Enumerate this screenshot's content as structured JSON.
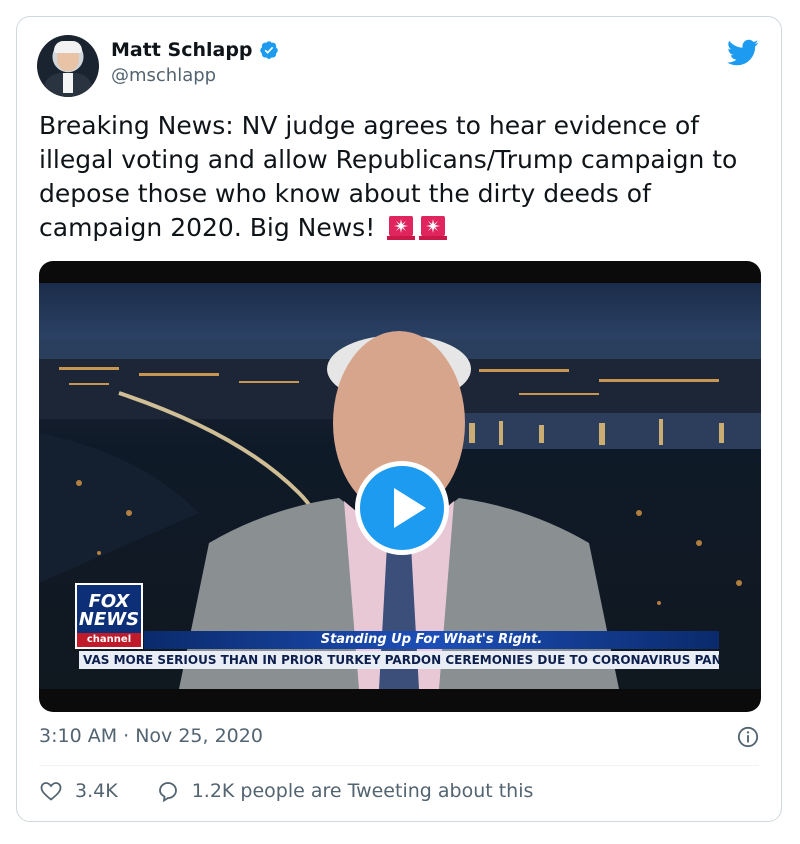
{
  "author": {
    "name": "Matt Schlapp",
    "handle": "@mschlapp"
  },
  "tweet": {
    "text": "Breaking News: NV judge agrees to hear evidence of illegal voting and allow Republicans/Trump campaign to depose those who know about the dirty deeds of campaign 2020. Big News!",
    "emojis": [
      "rotating-light",
      "rotating-light"
    ],
    "timestamp": "3:10 AM · Nov 25, 2020"
  },
  "video": {
    "logo_line1": "FOX",
    "logo_line2": "NEWS",
    "logo_channel": "channel",
    "ticker_top": "Standing Up For What's Right.",
    "ticker_bottom": "VAS MORE SERIOUS THAN IN PRIOR TURKEY PARDON CEREMONIES DUE TO CORONAVIRUS PANDEMIC..."
  },
  "actions": {
    "likes": "3.4K",
    "tweeting": "1.2K people are Tweeting about this"
  },
  "colors": {
    "brand": "#1d9bf0",
    "text": "#0f1419",
    "secondary": "#536471"
  },
  "icons": {
    "verified": "verified-badge-icon",
    "bird": "twitter-bird-icon",
    "info": "info-icon",
    "heart": "heart-icon",
    "reply": "speech-bubble-icon",
    "play": "play-icon"
  }
}
